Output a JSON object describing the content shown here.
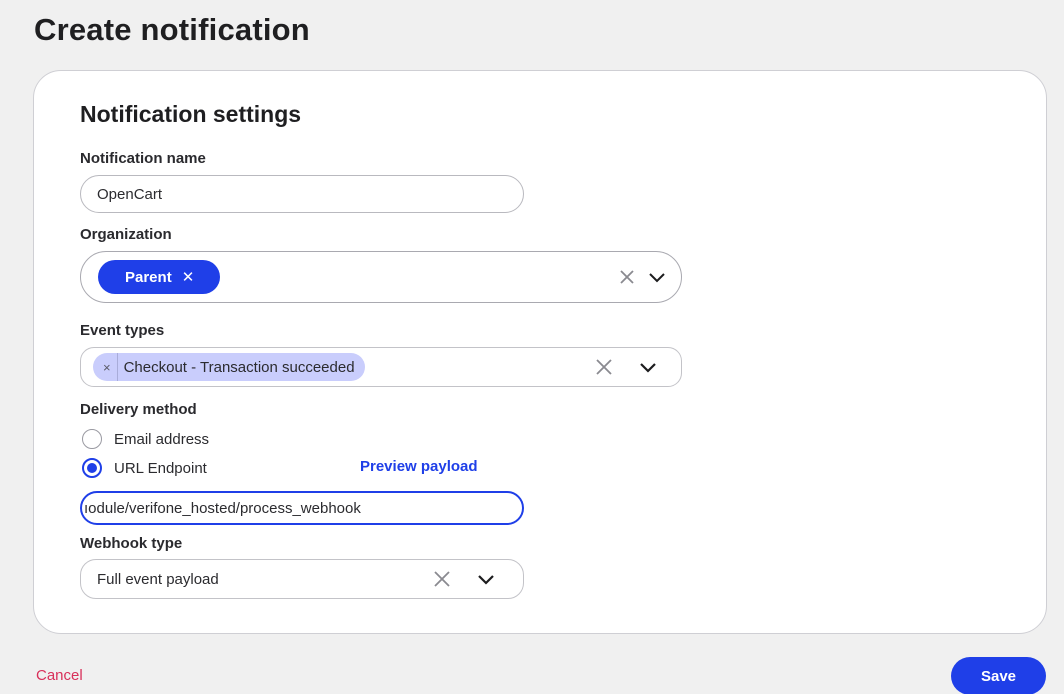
{
  "page": {
    "title": "Create notification"
  },
  "settings": {
    "title": "Notification settings",
    "name": {
      "label": "Notification name",
      "value": "OpenCart"
    },
    "organization": {
      "label": "Organization",
      "selected": [
        "Parent"
      ],
      "chip_remove_glyph": "✕"
    },
    "event_types": {
      "label": "Event types",
      "selected": [
        "Checkout - Transaction succeeded"
      ],
      "chip_remove_glyph": "×"
    },
    "delivery": {
      "label": "Delivery method",
      "options": [
        {
          "label": "Email address",
          "checked": false
        },
        {
          "label": "URL Endpoint",
          "checked": true
        }
      ],
      "preview_link": "Preview payload",
      "url_value": "ıodule/verifone_hosted/process_webhook"
    },
    "webhook_type": {
      "label": "Webhook type",
      "value": "Full event payload"
    }
  },
  "footer": {
    "cancel_label": "Cancel",
    "save_label": "Save"
  },
  "colors": {
    "accent": "#1f3fe8",
    "chip_light": "#c9cdfc",
    "cancel": "#d8305a"
  },
  "icons": {
    "clear": "close-icon",
    "expand": "chevron-down-icon"
  }
}
